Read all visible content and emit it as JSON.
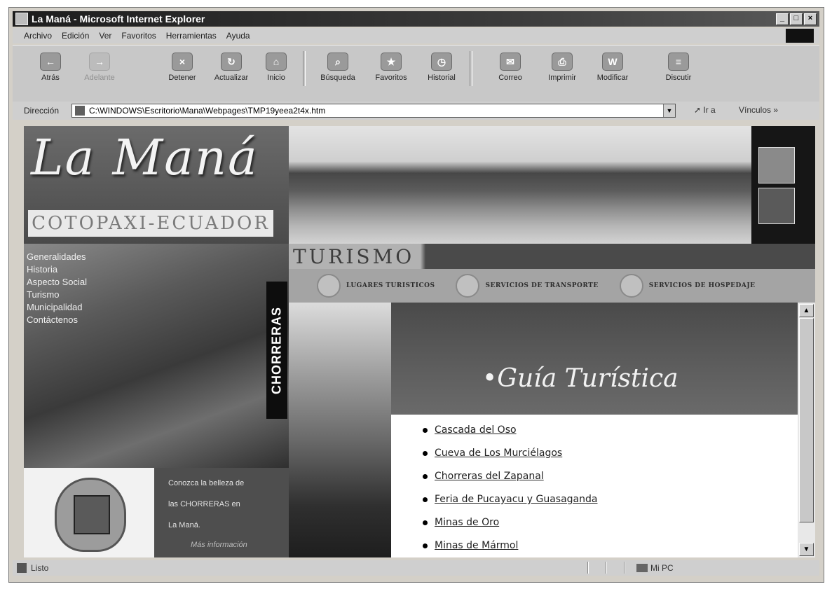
{
  "window": {
    "title": "La Maná - Microsoft Internet Explorer",
    "controls": [
      "_",
      "□",
      "×"
    ]
  },
  "menu": [
    "Archivo",
    "Edición",
    "Ver",
    "Favoritos",
    "Herramientas",
    "Ayuda"
  ],
  "toolbar": {
    "back": "Atrás",
    "forward": "Adelante",
    "stop": "Detener",
    "refresh": "Actualizar",
    "home": "Inicio",
    "search": "Búsqueda",
    "favorites": "Favoritos",
    "history": "Historial",
    "mail": "Correo",
    "print": "Imprimir",
    "edit": "Modificar",
    "discuss": "Discutir"
  },
  "address": {
    "label": "Dirección",
    "url": "C:\\WINDOWS\\Escritorio\\Mana\\Webpages\\TMP19yeea2t4x.htm",
    "go": "Ir a",
    "links": "Vínculos"
  },
  "site": {
    "logo_title": "La Maná",
    "logo_subtitle": "COTOPAXI-ECUADOR",
    "section_title": "TURISMO",
    "subnav": [
      "LUGARES TURISTICOS",
      "SERVICIOS DE TRANSPORTE",
      "SERVICIOS DE HOSPEDAJE"
    ],
    "sidenav": [
      "Generalidades",
      "Historia",
      "Aspecto Social",
      "Turismo",
      "Municipalidad",
      "Contáctenos"
    ],
    "vertical_label": "CHORRERAS",
    "promo": [
      "Conozca la belleza de",
      "las CHORRERAS en",
      "La Maná.",
      "Más información"
    ],
    "guide_title": "•Guía Turística",
    "places": [
      "Cascada del Oso",
      "Cueva de Los Murciélagos",
      "Chorreras del Zapanal",
      "Feria de Pucayacu y Guasaganda",
      "Minas de Oro",
      "Minas de Mármol"
    ]
  },
  "status": {
    "text": "Listo",
    "zone": "Mi PC"
  }
}
